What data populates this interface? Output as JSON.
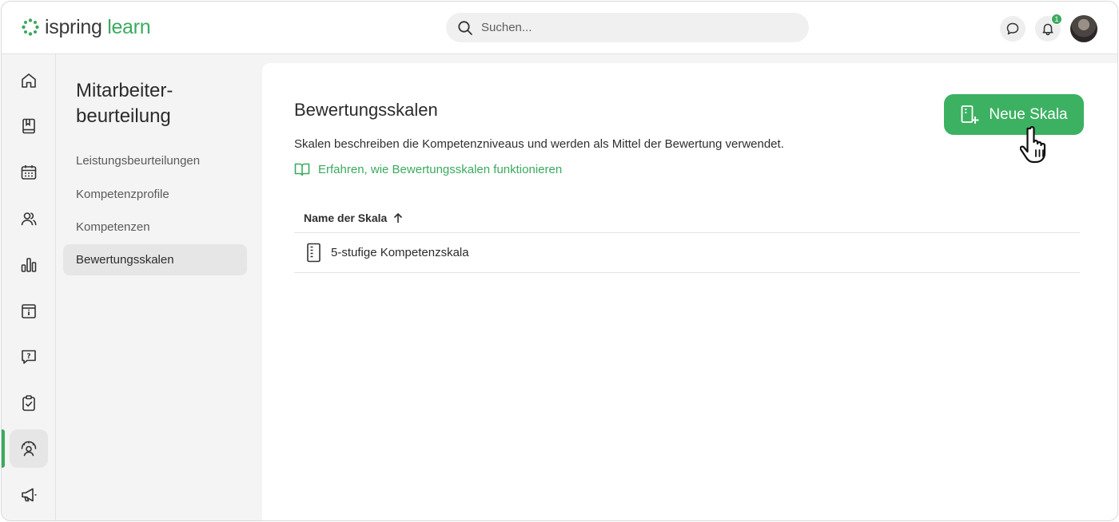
{
  "app": {
    "logo_part1": "ispring",
    "logo_part2": "learn",
    "brand_color": "#3aaa5f"
  },
  "search": {
    "placeholder": "Suchen..."
  },
  "header": {
    "notification_count": "1"
  },
  "rail": {
    "items": [
      {
        "icon": "home-icon"
      },
      {
        "icon": "book-icon"
      },
      {
        "icon": "calendar-icon"
      },
      {
        "icon": "users-icon"
      },
      {
        "icon": "bar-chart-icon"
      },
      {
        "icon": "info-box-icon"
      },
      {
        "icon": "question-chat-icon"
      },
      {
        "icon": "clipboard-check-icon"
      },
      {
        "icon": "performance-review-icon",
        "active": true
      },
      {
        "icon": "megaphone-icon"
      }
    ]
  },
  "subnav": {
    "title": "Mitarbeiter-beurteilung",
    "items": [
      {
        "label": "Leistungsbeurteilungen"
      },
      {
        "label": "Kompetenzprofile"
      },
      {
        "label": "Kompetenzen"
      },
      {
        "label": "Bewertungsskalen",
        "active": true
      }
    ]
  },
  "main": {
    "title": "Bewertungsskalen",
    "description": "Skalen beschreiben die Kompetenzniveaus und werden als Mittel der Bewertung verwendet.",
    "help_link": "Erfahren, wie Bewertungsskalen funktionieren",
    "new_button": "Neue Skala",
    "table": {
      "column_header": "Name der Skala",
      "sort": "ascending",
      "rows": [
        {
          "name": "5-stufige Kompetenzskala"
        }
      ]
    }
  }
}
